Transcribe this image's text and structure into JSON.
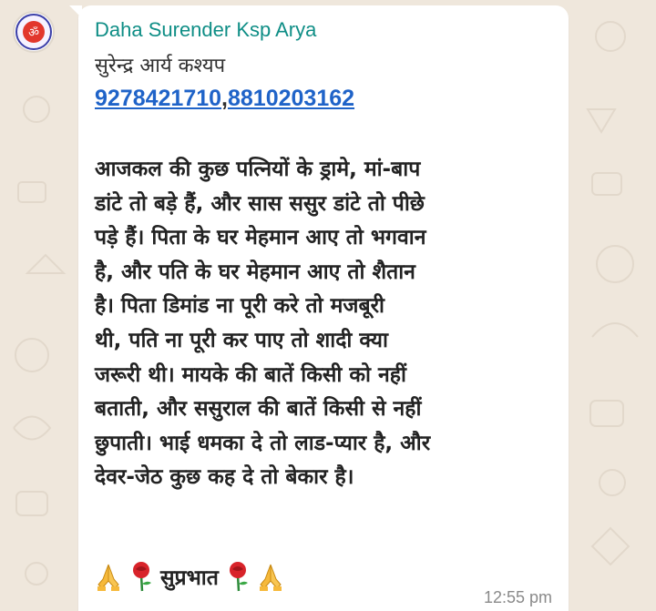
{
  "chat": {
    "sender_name": "Daha Surender Ksp Arya",
    "sender_subtitle": "सुरेन्द्र आर्य कश्यप",
    "phone_1": "9278421710",
    "phone_separator": ",",
    "phone_2": "8810203162",
    "body_lines": [
      "आजकल की कुछ पत्नियों के ड्रामे, मां-बाप",
      "डांटे तो बड़े हैं, और सास ससुर डांटे तो पीछे",
      "पड़े हैं। पिता के घर मेहमान आए तो भगवान",
      "है, और पति के घर मेहमान आए तो शैतान",
      "है। पिता डिमांड ना पूरी करे तो मजबूरी",
      "थी, पति ना पूरी कर पाए तो शादी क्या",
      "जरूरी थी। मायके की बातें किसी को नहीं",
      "बताती, और ससुराल की बातें किसी से नहीं",
      "छुपाती। भाई धमका दे तो लाड-प्यार है, और",
      "देवर-जेठ कुछ कह दे तो बेकार है।"
    ],
    "greeting_text": "सुप्रभात",
    "greeting_icons": [
      "folded-hands-icon",
      "rose-icon",
      "rose-icon",
      "folded-hands-icon"
    ],
    "timestamp": "12:55 pm",
    "avatar_symbol": "ॐ"
  },
  "colors": {
    "sender_name": "#0f8e86",
    "link": "#1f63c8",
    "bubble": "#ffffff",
    "wallpaper": "#efe7dc",
    "timestamp": "#8a8a8a"
  }
}
